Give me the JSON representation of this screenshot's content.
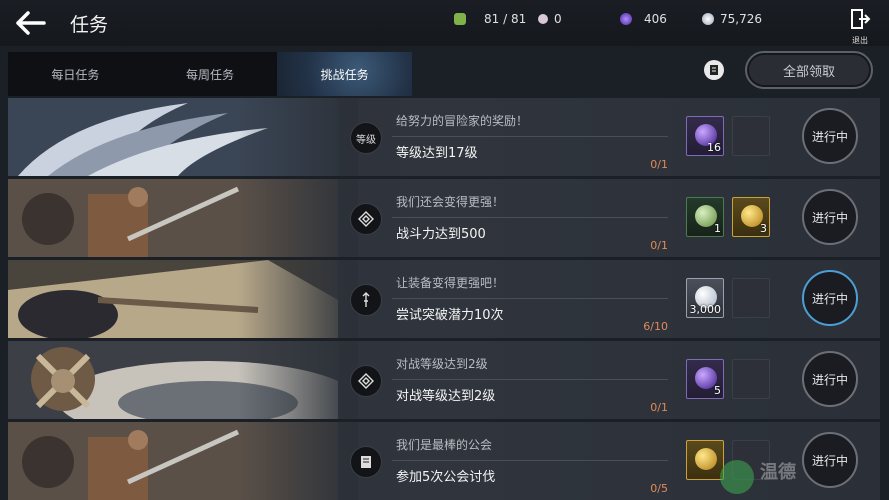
{
  "header": {
    "title": "任务",
    "exit_label": "退出",
    "resources": [
      {
        "name": "stamina",
        "value": "81 / 81",
        "color": "#7fb34a",
        "icon": "stamina-icon"
      },
      {
        "name": "pearl",
        "value": "0",
        "color": "#d9c8d8",
        "icon": "pearl-icon"
      },
      {
        "name": "purple-gem",
        "value": "406",
        "color": "#8b5cf0",
        "icon": "purple-gem-icon"
      },
      {
        "name": "silver-coin",
        "value": "75,726",
        "color": "#c9d3e0",
        "icon": "silver-coin-icon"
      }
    ]
  },
  "tabs": [
    {
      "label": "每日任务",
      "active": false
    },
    {
      "label": "每周任务",
      "active": false
    },
    {
      "label": "挑战任务",
      "active": true
    }
  ],
  "claim_all_label": "全部领取",
  "tasks": [
    {
      "subtitle": "给努力的冒险家的奖励！",
      "task": "等级达到17级",
      "category_label": "等级",
      "progress": "0/1",
      "status": "进行中",
      "rewards": [
        {
          "type": "purple",
          "qty": "16"
        },
        {
          "type": "empty",
          "qty": ""
        }
      ]
    },
    {
      "subtitle": "我们还会变得更强！",
      "task": "战斗力达到500",
      "category_label": "",
      "progress": "0/1",
      "status": "进行中",
      "rewards": [
        {
          "type": "green",
          "qty": "1"
        },
        {
          "type": "gold",
          "qty": "3"
        }
      ]
    },
    {
      "subtitle": "让装备变得更强吧！",
      "task": "尝试突破潜力10次",
      "category_label": "",
      "progress": "6/10",
      "status": "进行中",
      "rewards": [
        {
          "type": "silver",
          "qty": "3,000"
        },
        {
          "type": "empty",
          "qty": ""
        }
      ]
    },
    {
      "subtitle": "对战等级达到2级",
      "task": "对战等级达到2级",
      "category_label": "",
      "progress": "0/1",
      "status": "进行中",
      "rewards": [
        {
          "type": "purple",
          "qty": "5"
        },
        {
          "type": "empty",
          "qty": ""
        }
      ]
    },
    {
      "subtitle": "我们是最棒的公会",
      "task": "参加5次公会讨伐",
      "category_label": "",
      "progress": "0/5",
      "status": "进行中",
      "rewards": [
        {
          "type": "gold",
          "qty": ""
        },
        {
          "type": "empty",
          "qty": ""
        }
      ]
    }
  ],
  "watermark": "温德"
}
